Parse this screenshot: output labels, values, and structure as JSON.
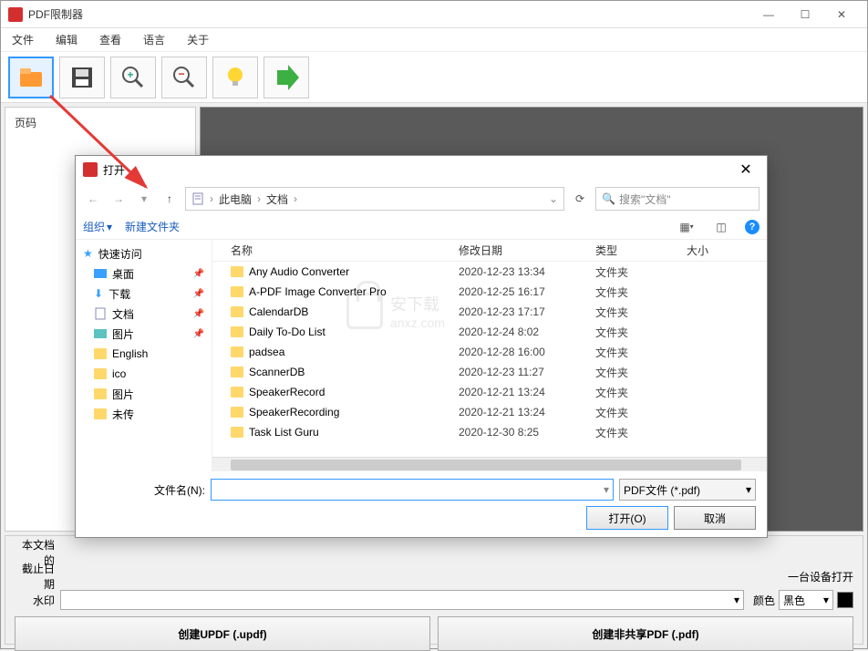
{
  "window": {
    "title": "PDF限制器"
  },
  "menu": {
    "file": "文件",
    "edit": "编辑",
    "view": "查看",
    "lang": "语言",
    "about": "关于"
  },
  "sidebar": {
    "pageTab": "页码"
  },
  "bottom": {
    "docLabel": "本文档的",
    "dateLabel": "截止日期",
    "watermark": "水印",
    "deviceSuffix": "一台设备打开",
    "colorLabel": "颜色",
    "colorValue": "黑色",
    "btnCreateUPDF": "创建UPDF (.updf)",
    "btnCreateNonShare": "创建非共享PDF (.pdf)"
  },
  "dialog": {
    "title": "打开",
    "breadcrumb": {
      "root": "此电脑",
      "folder": "文档"
    },
    "searchPlaceholder": "搜索\"文档\"",
    "organize": "组织",
    "newFolder": "新建文件夹",
    "columns": {
      "name": "名称",
      "date": "修改日期",
      "type": "类型",
      "size": "大小"
    },
    "navTree": {
      "quickAccess": "快速访问",
      "desktop": "桌面",
      "downloads": "下载",
      "documents": "文档",
      "pictures": "图片",
      "english": "English",
      "ico": "ico",
      "pictures2": "图片",
      "weizhuan": "未传"
    },
    "files": [
      {
        "name": "Any Audio Converter",
        "date": "2020-12-23 13:34",
        "type": "文件夹"
      },
      {
        "name": "A-PDF Image Converter Pro",
        "date": "2020-12-25 16:17",
        "type": "文件夹"
      },
      {
        "name": "CalendarDB",
        "date": "2020-12-23 17:17",
        "type": "文件夹"
      },
      {
        "name": "Daily To-Do List",
        "date": "2020-12-24 8:02",
        "type": "文件夹"
      },
      {
        "name": "padsea",
        "date": "2020-12-28 16:00",
        "type": "文件夹"
      },
      {
        "name": "ScannerDB",
        "date": "2020-12-23 11:27",
        "type": "文件夹"
      },
      {
        "name": "SpeakerRecord",
        "date": "2020-12-21 13:24",
        "type": "文件夹"
      },
      {
        "name": "SpeakerRecording",
        "date": "2020-12-21 13:24",
        "type": "文件夹"
      },
      {
        "name": "Task List Guru",
        "date": "2020-12-30 8:25",
        "type": "文件夹"
      }
    ],
    "fileNameLabel": "文件名(N):",
    "filterLabel": "PDF文件 (*.pdf)",
    "openBtn": "打开(O)",
    "cancelBtn": "取消"
  },
  "watermarkText": "anxz.com"
}
